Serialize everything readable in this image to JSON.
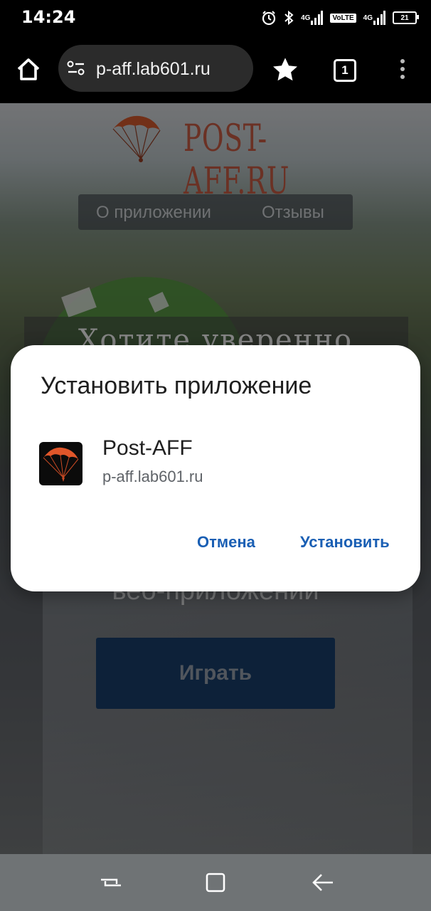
{
  "status_bar": {
    "time": "14:24",
    "icons": [
      "alarm-icon",
      "bluetooth-icon",
      "signal-4g-icon",
      "volte-icon",
      "signal-4g-icon",
      "battery-icon"
    ],
    "net1": "4G",
    "volte": "VoLTE",
    "net2": "4G",
    "battery": "21"
  },
  "browser": {
    "url": "p-aff.lab601.ru",
    "tab_count": "1",
    "icons": [
      "home-icon",
      "site-settings-icon",
      "star-icon",
      "tabs-icon",
      "more-vert-icon"
    ]
  },
  "page": {
    "logo_text": "Post-AFF.ru",
    "nav": [
      "О приложении",
      "Отзывы"
    ],
    "hero_title": "Хотите уверенно",
    "hero_subtitle": "веб-приложении",
    "play_label": "Играть"
  },
  "dialog": {
    "title": "Установить приложение",
    "app_name": "Post-AFF",
    "app_url": "p-aff.lab601.ru",
    "cancel_label": "Отмена",
    "install_label": "Установить"
  },
  "colors": {
    "accent": "#1a5fb4",
    "logo": "#b9553f",
    "play_button": "#173a63",
    "dialog_bg": "#ffffff"
  },
  "system_nav": {
    "icons": [
      "recents-icon",
      "home-square-icon",
      "back-icon"
    ]
  }
}
